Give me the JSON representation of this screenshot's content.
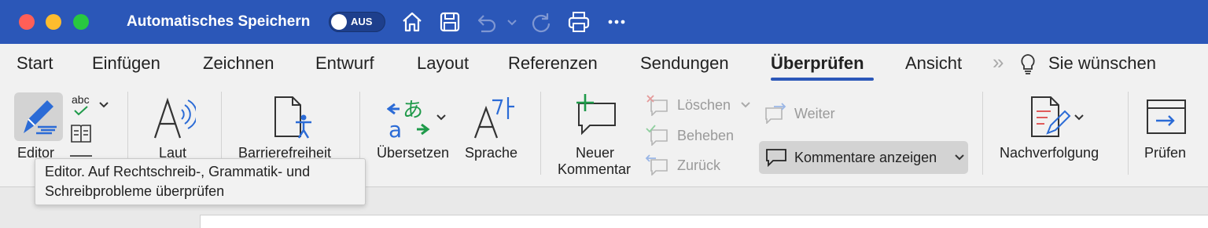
{
  "titlebar": {
    "autosave_label": "Automatisches Speichern",
    "toggle_text": "AUS",
    "bg_color": "#2b57b8",
    "icons": [
      "home-icon",
      "save-icon",
      "undo-icon",
      "undo-dropdown-icon",
      "redo-icon",
      "print-icon",
      "more-icon"
    ]
  },
  "tabs": {
    "start": "Start",
    "einfuegen": "Einfügen",
    "zeichnen": "Zeichnen",
    "entwurf": "Entwurf",
    "layout": "Layout",
    "referenzen": "Referenzen",
    "sendungen": "Sendungen",
    "ueberpruefen": "Überprüfen",
    "ansicht": "Ansicht",
    "overflow": "»",
    "tell_me": "Sie wünschen"
  },
  "ribbon": {
    "editor": "Editor",
    "laut": "Laut",
    "barrierefreiheit": "Barrierefreiheit",
    "uebersetzen": "Übersetzen",
    "sprache": "Sprache",
    "neuer_kommentar_1": "Neuer",
    "neuer_kommentar_2": "Kommentar",
    "loeschen": "Löschen",
    "beheben": "Beheben",
    "zurueck": "Zurück",
    "weiter": "Weiter",
    "kommentare_anzeigen": "Kommentare anzeigen",
    "nachverfolgung": "Nachverfolgung",
    "pruefen": "Prüfen",
    "abc": "abc"
  },
  "tooltip": {
    "line1": "Editor. Auf Rechtschreib-, Grammatik- und",
    "line2": "Schreibprobleme überprüfen"
  }
}
